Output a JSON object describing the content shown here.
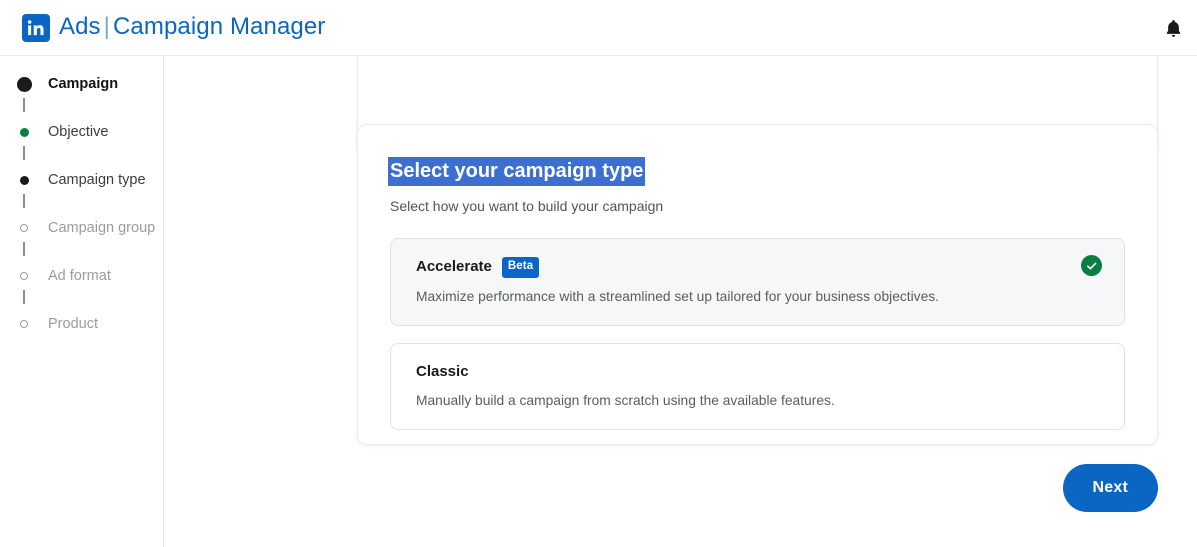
{
  "header": {
    "logo_icon": "linkedin-icon",
    "brand_primary": "Ads",
    "brand_separator": "|",
    "brand_secondary": "Campaign Manager",
    "bell_icon": "notification-bell-icon"
  },
  "sidebar": {
    "steps": [
      {
        "label": "Campaign",
        "state": "current",
        "marker": "dot-large-filled"
      },
      {
        "label": "Objective",
        "state": "done",
        "marker": "dot-green-filled"
      },
      {
        "label": "Campaign type",
        "state": "active",
        "marker": "dot-small-filled"
      },
      {
        "label": "Campaign group",
        "state": "todo",
        "marker": "dot-hollow"
      },
      {
        "label": "Ad format",
        "state": "todo",
        "marker": "dot-hollow"
      },
      {
        "label": "Product",
        "state": "todo",
        "marker": "dot-hollow"
      }
    ]
  },
  "main": {
    "section": {
      "title": "Select your campaign type",
      "subtitle": "Select how you want to build your campaign",
      "title_highlighted": true
    },
    "options": [
      {
        "title": "Accelerate",
        "badge": "Beta",
        "description": "Maximize performance with a streamlined set up tailored for your business objectives.",
        "selected": true,
        "check_icon": "check-circle-icon"
      },
      {
        "title": "Classic",
        "badge": "",
        "description": "Manually build a campaign from scratch using the available features.",
        "selected": false,
        "check_icon": ""
      }
    ],
    "next_label": "Next"
  },
  "colors": {
    "brand_blue": "#0a66c2",
    "selection_highlight": "#3d6fd1",
    "success_green": "#0a7d43",
    "selected_card_bg": "#f5f7f9",
    "text_primary": "#1a1a1a",
    "text_muted": "#9c9c9c"
  }
}
